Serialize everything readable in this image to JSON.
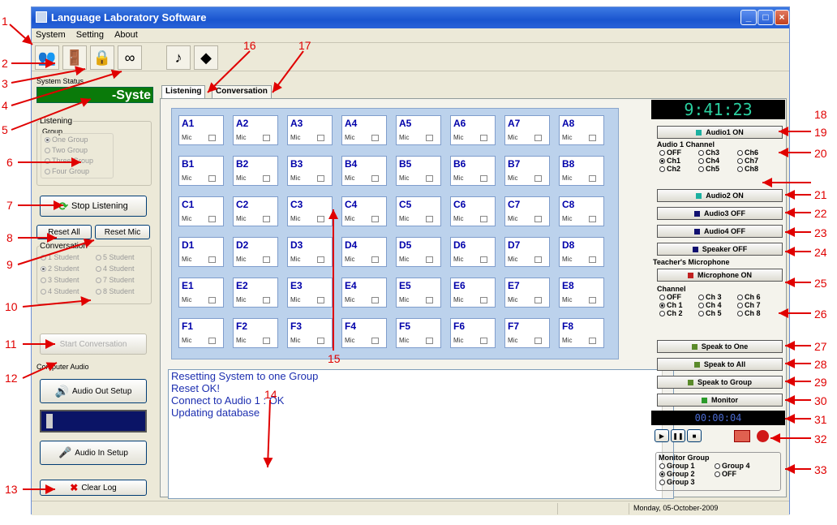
{
  "window": {
    "title": "Language Laboratory Software"
  },
  "menu": [
    "System",
    "Setting",
    "About"
  ],
  "left": {
    "system_status_label": "System Status",
    "system_status_text": "-Syste",
    "listening_label": "Listening",
    "group_label": "Group",
    "group_options": [
      "One Group",
      "Two Group",
      "Three Group",
      "Four Group"
    ],
    "stop_listening": "Stop Listening",
    "reset_all": "Reset All",
    "reset_mic": "Reset Mic",
    "conversation_label": "Conversation",
    "conversation_options": [
      "1 Student",
      "5 Student",
      "2 Student",
      "4 Student",
      "3 Student",
      "7 Student",
      "4 Student",
      "8 Student"
    ],
    "start_conversation": "Start Conversation",
    "computer_audio_label": "Computer Audio",
    "audio_out_setup": "Audio Out Setup",
    "audio_in_setup": "Audio In Setup",
    "clear_log": "Clear Log"
  },
  "tabs": [
    "Listening",
    "Conversation"
  ],
  "grid": {
    "mic_label": "Mic",
    "rows": [
      [
        "A1",
        "A2",
        "A3",
        "A4",
        "A5",
        "A6",
        "A7",
        "A8"
      ],
      [
        "B1",
        "B2",
        "B3",
        "B4",
        "B5",
        "B6",
        "B7",
        "B8"
      ],
      [
        "C1",
        "C2",
        "C3",
        "C4",
        "C5",
        "C6",
        "C7",
        "C8"
      ],
      [
        "D1",
        "D2",
        "D3",
        "D4",
        "D5",
        "D6",
        "D7",
        "D8"
      ],
      [
        "E1",
        "E2",
        "E3",
        "E4",
        "E5",
        "E6",
        "E7",
        "E8"
      ],
      [
        "F1",
        "F2",
        "F3",
        "F4",
        "F5",
        "F6",
        "F7",
        "F8"
      ]
    ]
  },
  "log": [
    "Resetting System to one Group",
    "Reset OK!",
    "Connect to Audio 1 : OK",
    "Updating database"
  ],
  "right": {
    "clock": "9:41:23",
    "audio1": "Audio1 ON",
    "audio1_channel_label": "Audio 1 Channel",
    "audio1_channels": [
      "OFF",
      "Ch3",
      "Ch6",
      "Ch1",
      "Ch4",
      "Ch7",
      "Ch2",
      "Ch5",
      "Ch8"
    ],
    "audio2": "Audio2 ON",
    "audio3": "Audio3 OFF",
    "audio4": "Audio4 OFF",
    "speaker": "Speaker OFF",
    "teacher_mic_label": "Teacher's Microphone",
    "microphone": "Microphone ON",
    "channel_label": "Channel",
    "channels": [
      "OFF",
      "Ch 3",
      "Ch 6",
      "Ch 1",
      "Ch 4",
      "Ch 7",
      "Ch 2",
      "Ch 5",
      "Ch 8"
    ],
    "speak_to_one": "Speak to One",
    "speak_to_all": "Speak to All",
    "speak_to_group": "Speak to Group",
    "monitor": "Monitor",
    "timer": "00:00:04",
    "monitor_group_label": "Monitor Group",
    "monitor_groups": [
      "Group 1",
      "Group 4",
      "Group 2",
      "OFF",
      "Group 3"
    ]
  },
  "status": {
    "date": "Monday, 05-October-2009"
  },
  "annotations": [
    "1",
    "2",
    "3",
    "4",
    "5",
    "6",
    "7",
    "8",
    "9",
    "10",
    "11",
    "12",
    "13",
    "14",
    "15",
    "16",
    "17",
    "18",
    "19",
    "20",
    "21",
    "22",
    "23",
    "24",
    "25",
    "26",
    "27",
    "28",
    "29",
    "30",
    "31",
    "32",
    "33"
  ],
  "colors": {
    "accent_green": "#2aa82a",
    "status_green": "#1c8a1c",
    "annotation_red": "#e00000",
    "grid_bg": "#bcd2ec"
  }
}
